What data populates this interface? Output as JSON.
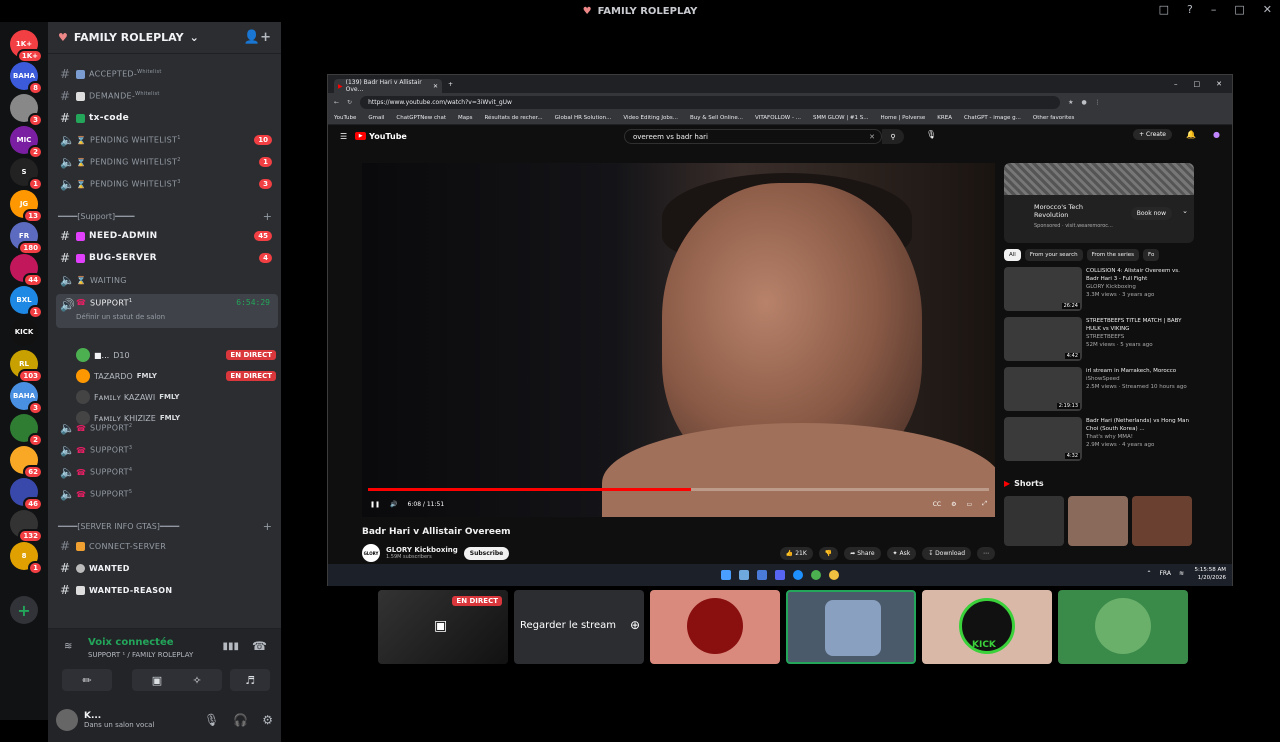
{
  "window": {
    "title": "FAMILY ROLEPLAY"
  },
  "guilds": [
    {
      "label": "1K+",
      "badge": "1K+",
      "color": "#f23f43"
    },
    {
      "label": "BAHA",
      "badge": "8",
      "color": "#3b5bdb"
    },
    {
      "label": "",
      "badge": "3",
      "color": "#888"
    },
    {
      "label": "MIC",
      "badge": "2",
      "color": "#7b1fa2"
    },
    {
      "label": "S",
      "badge": "1",
      "color": "#222"
    },
    {
      "label": "JG",
      "badge": "13",
      "color": "#ff9800"
    },
    {
      "label": "FR",
      "badge": "180",
      "color": "#5c6bc0"
    },
    {
      "label": "",
      "badge": "44",
      "color": "#c2185b"
    },
    {
      "label": "BXL",
      "badge": "1",
      "color": "#1e88e5"
    },
    {
      "label": "KICK",
      "badge": "",
      "color": "#111"
    },
    {
      "label": "RL",
      "badge": "103",
      "color": "#c8a000"
    },
    {
      "label": "BAHA",
      "badge": "3",
      "color": "#4a90e2"
    },
    {
      "label": "",
      "badge": "2",
      "color": "#2e7d32"
    },
    {
      "label": "",
      "badge": "62",
      "color": "#f9a825"
    },
    {
      "label": "",
      "badge": "46",
      "color": "#3949ab"
    },
    {
      "label": "",
      "badge": "132",
      "color": "#333"
    },
    {
      "label": "8",
      "badge": "1",
      "color": "#e0a000"
    }
  ],
  "server": {
    "name": "FAMILY ROLEPLAY"
  },
  "channels": {
    "accepted": "ACCEPTED-",
    "accepted_sup": "Whitelist",
    "demande": "DEMANDE-",
    "demande_sup": "Whitelist",
    "txcode": "tx-code",
    "pw1": "PENDING WHITELIST",
    "pw1_sup": "1",
    "pw1_badge": "10",
    "pw2": "PENDING WHITELIST",
    "pw2_sup": "2",
    "pw2_badge": "1",
    "pw3": "PENDING WHITELIST",
    "pw3_sup": "3",
    "pw3_badge": "3",
    "cat_support": "━━━━[Support]━━━━",
    "need_admin": "NEED-ADMIN",
    "need_admin_badge": "45",
    "bug_server": "BUG-SERVER",
    "bug_server_badge": "4",
    "waiting": "WAITING",
    "support1": "SUPPORT",
    "support1_sup": "1",
    "support1_time": "6:54:29",
    "status_hint": "Définir un statut de salon",
    "vc_users": [
      {
        "name": "D10",
        "prefix": "■...",
        "live": "EN DIRECT",
        "tag": "",
        "color": "#4caf50"
      },
      {
        "name": "TAZARDO",
        "prefix": "",
        "live": "EN DIRECT",
        "tag": "FMLY",
        "color": "#ff9800"
      },
      {
        "name": "Fᴀᴍɪʟʏ KAZAWI",
        "prefix": "",
        "live": "",
        "tag": "FMLY",
        "color": "#444"
      },
      {
        "name": "Fᴀᴍɪʟʏ KHIZIZE",
        "prefix": "",
        "live": "",
        "tag": "FMLY",
        "color": "#444"
      }
    ],
    "support2": "SUPPORT",
    "support2_sup": "2",
    "support3": "SUPPORT",
    "support3_sup": "3",
    "support4": "SUPPORT",
    "support4_sup": "4",
    "support5": "SUPPORT",
    "support5_sup": "5",
    "cat_info": "━━━━[SERVER INFO GTAS]━━━━",
    "connect": "CONNECT-SERVER",
    "wanted": "WANTED",
    "wanted_reason": "WANTED-REASON"
  },
  "voice": {
    "status": "Voix connectée",
    "location": "SUPPORT ¹ / FAMILY ROLEPLAY"
  },
  "user": {
    "name": "K...",
    "status": "Dans un salon vocal"
  },
  "browser": {
    "tab_title": "(139) Badr Hari v Allistair Ove...",
    "url": "https://www.youtube.com/watch?v=3iWvit_gUw",
    "bookmarks": [
      "YouTube",
      "Gmail",
      "ChatGPTNew chat",
      "Maps",
      "Résultats de recher...",
      "Global HR Solution...",
      "Video Editing Jobs...",
      "Buy & Sell Online...",
      "VITAFOLLOW - ...",
      "SMM GLOW | #1 S...",
      "Home | Polverse",
      "KREA",
      "ChatGPT - image g...",
      "Other favorites"
    ]
  },
  "youtube": {
    "logo": "YouTube",
    "search_value": "overeem vs badr hari",
    "create_label": "+ Create",
    "time": "6:08 / 11:51",
    "progress": 0.52,
    "video_title": "Badr Hari v Allistair Overeem",
    "channel_name": "GLORY Kickboxing",
    "subs": "1.59M subscribers",
    "subscribe": "Subscribe",
    "likes": "21K",
    "share": "Share",
    "ask": "Ask",
    "download": "Download",
    "ad_title": "Morocco's Tech Revolution",
    "ad_sponsor": "Sponsored · visit.wearemoroc...",
    "ad_cta": "Book now",
    "chips": [
      "All",
      "From your search",
      "From the series",
      "Fo"
    ],
    "recs": [
      {
        "title": "COLLISION 4: Alistair Overeem vs. Badr Hari 3 - Full Fight",
        "channel": "GLORY Kickboxing",
        "meta": "3.3M views · 3 years ago",
        "dur": "26:24"
      },
      {
        "title": "STREETBEEFS TITLE MATCH | BABY HULK vs VIKING",
        "channel": "STREETBEEFS",
        "meta": "52M views · 5 years ago",
        "dur": "4:42"
      },
      {
        "title": "irl stream in Marrakech, Morocco",
        "channel": "iShowSpeed",
        "meta": "2.5M views · Streamed 10 hours ago",
        "dur": "2:19:13"
      },
      {
        "title": "Badr Hari (Netherlands) vs Hong Man Choi (South Korea) ...",
        "channel": "That's why MMA!",
        "meta": "2.9M views · 4 years ago",
        "dur": "4:32"
      }
    ],
    "shorts": "Shorts"
  },
  "taskbar": {
    "lang": "FRA",
    "time": "5:15:58 AM",
    "date": "1/20/2026"
  },
  "tiles": {
    "live": "EN DIRECT",
    "watch_stream": "Regarder le stream",
    "kick": "KICK"
  }
}
